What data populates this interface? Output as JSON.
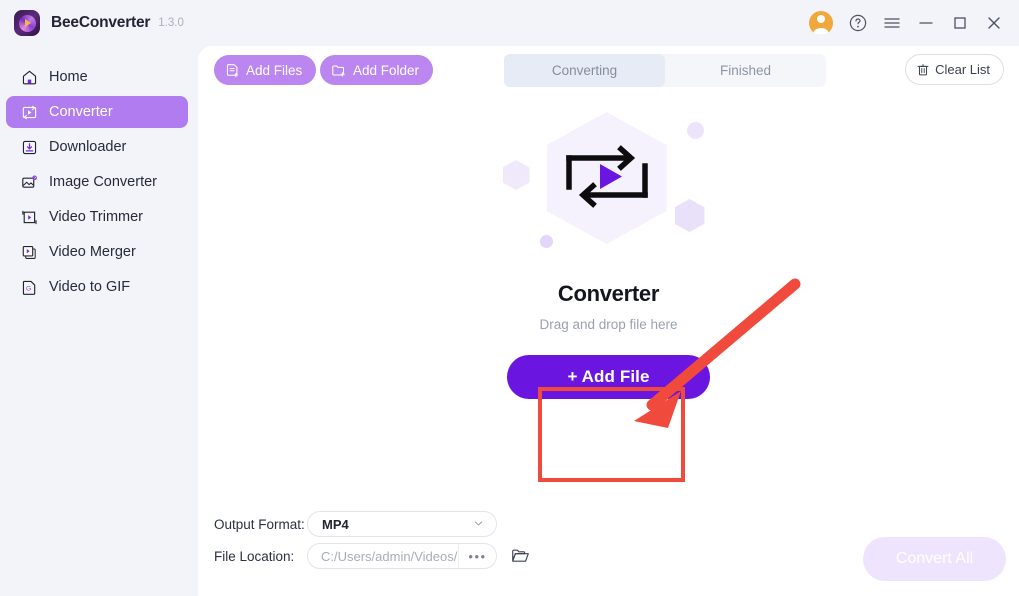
{
  "titlebar": {
    "app_name": "BeeConverter",
    "version": "1.3.0",
    "logo_icon": "beeconverter-logo-icon",
    "account_icon": "user-avatar-icon",
    "help_icon": "question-circle-icon",
    "menu_icon": "hamburger-menu-icon",
    "minimize_icon": "minimize-icon",
    "maximize_icon": "maximize-icon",
    "close_icon": "close-icon"
  },
  "sidebar": {
    "items": [
      {
        "label": "Home",
        "icon": "home-icon",
        "active": false
      },
      {
        "label": "Converter",
        "icon": "converter-icon",
        "active": true
      },
      {
        "label": "Downloader",
        "icon": "download-icon",
        "active": false
      },
      {
        "label": "Image Converter",
        "icon": "image-convert-icon",
        "active": false
      },
      {
        "label": "Video Trimmer",
        "icon": "video-trim-icon",
        "active": false
      },
      {
        "label": "Video Merger",
        "icon": "video-merge-icon",
        "active": false
      },
      {
        "label": "Video to GIF",
        "icon": "video-to-gif-icon",
        "active": false
      }
    ]
  },
  "toolbar": {
    "add_files_label": "Add Files",
    "add_files_icon": "add-file-icon",
    "add_folder_label": "Add Folder",
    "add_folder_icon": "add-folder-icon",
    "clear_list_label": "Clear List",
    "clear_list_icon": "trash-icon",
    "tabs": [
      {
        "label": "Converting",
        "active": true
      },
      {
        "label": "Finished",
        "active": false
      }
    ]
  },
  "empty_state": {
    "title": "Converter",
    "subtitle": "Drag and drop file here",
    "add_file_label": "+ Add File",
    "illustration_icon": "video-convert-hexagon-illustration"
  },
  "bottom": {
    "output_format_label": "Output Format:",
    "output_format_value": "MP4",
    "output_format_caret_icon": "chevron-down-icon",
    "file_location_label": "File Location:",
    "file_location_value": "C:/Users/admin/Videos/",
    "browse_dots_label": "•••",
    "open_folder_icon": "folder-open-icon",
    "convert_all_label": "Convert All"
  },
  "annotations": {
    "highlight_color": "#f04a3c",
    "arrow_icon": "red-pointer-arrow",
    "box_icon": "red-highlight-rectangle"
  }
}
